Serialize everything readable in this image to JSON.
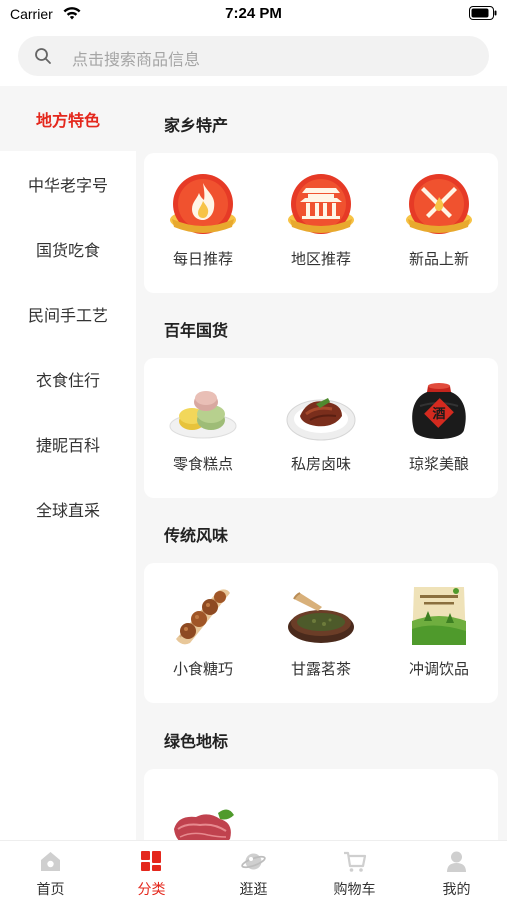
{
  "status_bar": {
    "carrier": "Carrier",
    "time": "7:24 PM"
  },
  "search": {
    "placeholder": "点击搜索商品信息"
  },
  "sidebar": {
    "items": [
      {
        "label": "地方特色",
        "active": true
      },
      {
        "label": "中华老字号"
      },
      {
        "label": "国货吃食"
      },
      {
        "label": "民间手工艺"
      },
      {
        "label": "衣食住行"
      },
      {
        "label": "捷昵百科"
      },
      {
        "label": "全球直采"
      }
    ]
  },
  "sections": [
    {
      "title": "家乡特产",
      "items": [
        {
          "label": "每日推荐",
          "icon": "flame-icon"
        },
        {
          "label": "地区推荐",
          "icon": "pavilion-icon"
        },
        {
          "label": "新品上新",
          "icon": "crossed-knives-icon"
        }
      ]
    },
    {
      "title": "百年国货",
      "items": [
        {
          "label": "零食糕点",
          "icon": "pastry-image"
        },
        {
          "label": "私房卤味",
          "icon": "braised-meat-image"
        },
        {
          "label": "琼浆美酿",
          "icon": "wine-jar-image"
        }
      ]
    },
    {
      "title": "传统风味",
      "items": [
        {
          "label": "小食糖巧",
          "icon": "snack-image"
        },
        {
          "label": "甘露茗茶",
          "icon": "tea-image"
        },
        {
          "label": "冲调饮品",
          "icon": "drink-bag-image"
        }
      ]
    },
    {
      "title": "绿色地标",
      "items": [
        {
          "label": "",
          "icon": "raw-meat-image"
        }
      ]
    }
  ],
  "tabbar": {
    "items": [
      {
        "label": "首页",
        "icon": "home-icon"
      },
      {
        "label": "分类",
        "icon": "category-icon",
        "active": true
      },
      {
        "label": "逛逛",
        "icon": "planet-icon"
      },
      {
        "label": "购物车",
        "icon": "cart-icon"
      },
      {
        "label": "我的",
        "icon": "user-icon"
      }
    ]
  },
  "colors": {
    "accent": "#e4281d",
    "background": "#f6f6f6",
    "badge_red": "#e63a26",
    "badge_gold": "#f7c346"
  }
}
